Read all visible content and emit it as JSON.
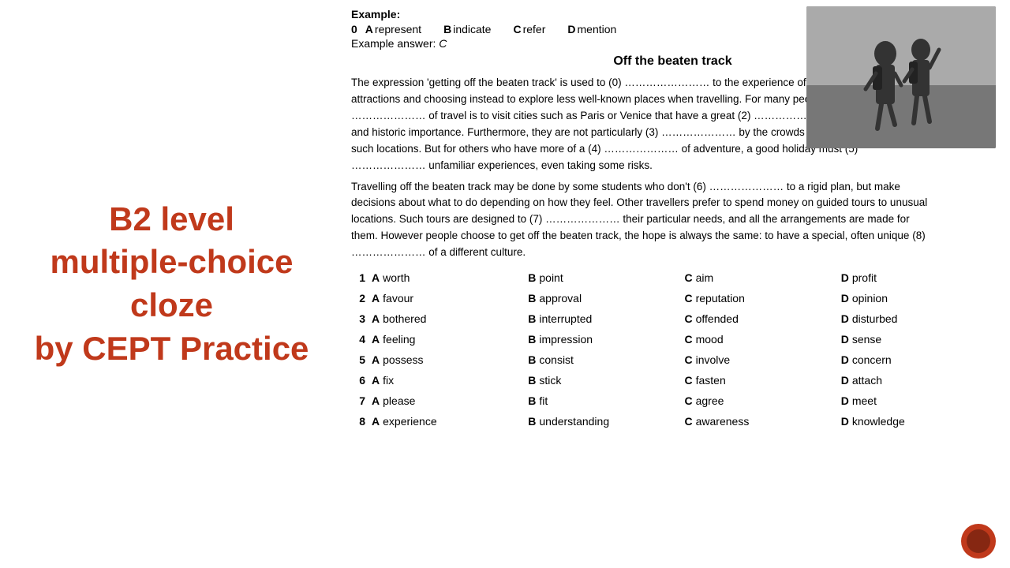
{
  "left": {
    "line1": "B2 level",
    "line2": "multiple-choice",
    "line3": "cloze",
    "line4": "by CEPT Practice"
  },
  "example": {
    "label": "Example:",
    "q_num": "0",
    "options": [
      {
        "letter": "A",
        "text": "represent"
      },
      {
        "letter": "B",
        "text": "indicate"
      },
      {
        "letter": "C",
        "text": "refer"
      },
      {
        "letter": "D",
        "text": "mention"
      }
    ],
    "answer_label": "Example answer:",
    "answer_value": "C"
  },
  "article": {
    "title": "Off the beaten track",
    "para1": "The expression 'getting off the beaten track' is used to (0) …………………… to the experience of avoiding famous tourist attractions and choosing instead to explore less well-known places when travelling. For many people the whole (1) ………………… of travel is to visit cities such as Paris or Venice that have a great (2) ………………… as places of beauty and historic importance. Furthermore, they are not particularly (3) ………………… by the crowds that are usually found in such locations. But for others who have more of a (4) ………………… of adventure, a good holiday must (5) ………………… unfamiliar experiences, even taking some risks.",
    "para2": "Travelling off the beaten track may be done by some students who don't (6) ………………… to a rigid plan, but make decisions about what to do depending on how they feel. Other travellers prefer to spend money on guided tours to unusual locations. Such tours are designed to (7) ………………… their particular needs, and all the arrangements are made for them. However people choose to get off the beaten track, the hope is always the same: to have a special, often unique (8) ………………… of a different culture."
  },
  "answers": [
    {
      "num": "1",
      "a": "worth",
      "b": "point",
      "c": "aim",
      "d": "profit"
    },
    {
      "num": "2",
      "a": "favour",
      "b": "approval",
      "c": "reputation",
      "d": "opinion"
    },
    {
      "num": "3",
      "a": "bothered",
      "b": "interrupted",
      "c": "offended",
      "d": "disturbed"
    },
    {
      "num": "4",
      "a": "feeling",
      "b": "impression",
      "c": "mood",
      "d": "sense"
    },
    {
      "num": "5",
      "a": "possess",
      "b": "consist",
      "c": "involve",
      "d": "concern"
    },
    {
      "num": "6",
      "a": "fix",
      "b": "stick",
      "c": "fasten",
      "d": "attach"
    },
    {
      "num": "7",
      "a": "please",
      "b": "fit",
      "c": "agree",
      "d": "meet"
    },
    {
      "num": "8",
      "a": "experience",
      "b": "understanding",
      "c": "awareness",
      "d": "knowledge"
    }
  ]
}
